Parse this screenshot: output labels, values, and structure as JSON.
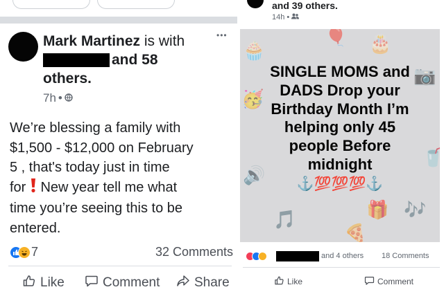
{
  "left_post": {
    "author": "Mark Martinez",
    "with_text": " is with",
    "and_text": "and 58",
    "others_text": "others.",
    "time": "7h",
    "body_lines": [
      "We’re blessing a family with",
      "$1,500 - $12,000  on February",
      "5 , that's today just in time",
      "for",
      " New year tell me what",
      "time you’re seeing this to be",
      "entered."
    ],
    "reaction_count": "7",
    "comments_count": "32 Comments",
    "actions": {
      "like": "Like",
      "comment": "Comment",
      "share": "Share"
    },
    "more_label": "•••"
  },
  "right_post": {
    "header_line": "and 39 others.",
    "time": "14h",
    "card_lines": [
      "SINGLE MOMS and",
      "DADS Drop your",
      "Birthday Month I’m",
      "helping only 45",
      "people Before",
      "midnight"
    ],
    "card_emoji": "⚓️💯💯💯⚓️",
    "others_text": "and 4 others",
    "comments_count": "18 Comments",
    "actions": {
      "like": "Like",
      "comment": "Comment"
    }
  },
  "colors": {
    "like_blue": "#1877f2",
    "love_red": "#f33e58",
    "haha_yellow": "#f7b125",
    "text_gray": "#606770"
  }
}
